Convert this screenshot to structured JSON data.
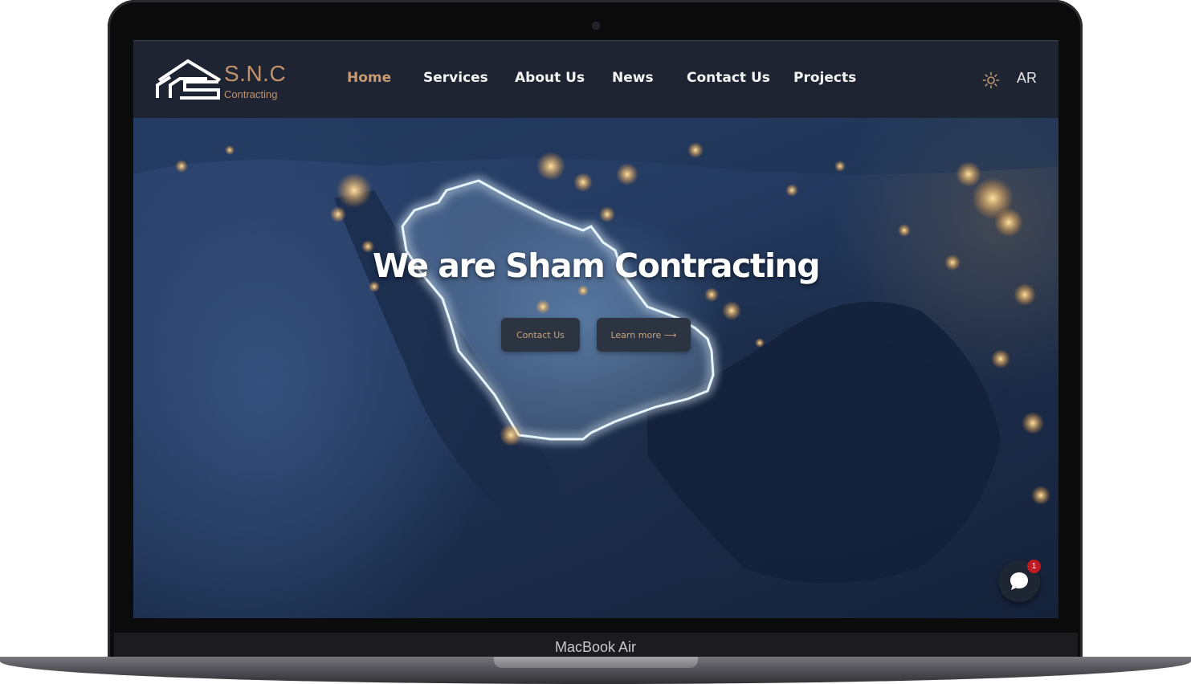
{
  "device": {
    "label": "MacBook Air"
  },
  "header": {
    "logo": {
      "title": "S.N.C",
      "subtitle": "Contracting"
    },
    "nav": [
      {
        "label": "Home",
        "active": true
      },
      {
        "label": "Services",
        "active": false
      },
      {
        "label": "About Us",
        "active": false
      },
      {
        "label": "News",
        "active": false
      },
      {
        "label": "Contact Us",
        "active": false
      },
      {
        "label": "Projects",
        "active": false
      }
    ],
    "theme_icon": "sun-icon",
    "language": "AR"
  },
  "hero": {
    "title": "We are Sham Contracting",
    "buttons": {
      "contact": "Contact Us",
      "learn_more": "Learn more ⟶"
    },
    "background": "night satellite map of the Arabian Peninsula with glowing border"
  },
  "chat": {
    "icon": "chat-bubble-icon",
    "badge_count": "1"
  },
  "colors": {
    "accent": "#c79a72",
    "navbar": "#1f2433",
    "button_bg": "#2b3440",
    "badge": "#c01a22"
  }
}
